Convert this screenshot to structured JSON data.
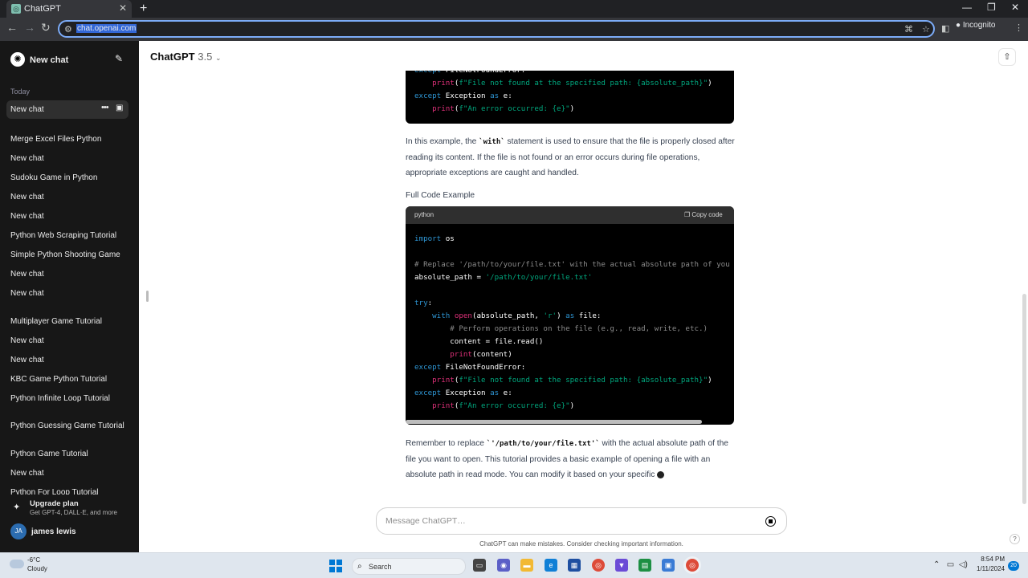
{
  "browser": {
    "tab_title": "ChatGPT",
    "url": "chat.openai.com",
    "incognito_label": "Incognito"
  },
  "sidebar": {
    "new_chat": "New chat",
    "section_today": "Today",
    "active_chat": "New chat",
    "history": [
      "Merge Excel Files Python",
      "New chat",
      "Sudoku Game in Python",
      "New chat",
      "New chat",
      "Python Web Scraping Tutorial",
      "Simple Python Shooting Game",
      "New chat",
      "New chat",
      "Multiplayer Game Tutorial",
      "New chat",
      "New chat",
      "KBC Game Python Tutorial",
      "Python Infinite Loop Tutorial",
      "Python Guessing Game Tutorial",
      "Python Game Tutorial",
      "New chat",
      "Python For Loop Tutorial"
    ],
    "upgrade_title": "Upgrade plan",
    "upgrade_sub": "Get GPT-4, DALL·E, and more",
    "user_initials": "JA",
    "user_name": "james lewis"
  },
  "header": {
    "model": "ChatGPT",
    "version": "3.5"
  },
  "message": {
    "code1_lines": [
      [
        [
          "kw",
          "except "
        ],
        [
          "",
          "FileNotFoundError:"
        ]
      ],
      [
        [
          "",
          "    "
        ],
        [
          "fn",
          "print"
        ],
        [
          "",
          "("
        ],
        [
          "st",
          "f\"File not found at the specified path: {absolute_path}\""
        ],
        [
          "",
          ")"
        ]
      ],
      [
        [
          "kw",
          "except "
        ],
        [
          "",
          "Exception "
        ],
        [
          "kw",
          "as "
        ],
        [
          "",
          "e:"
        ]
      ],
      [
        [
          "",
          "    "
        ],
        [
          "fn",
          "print"
        ],
        [
          "",
          "("
        ],
        [
          "st",
          "f\"An error occurred: {e}\""
        ],
        [
          "",
          ")"
        ]
      ]
    ],
    "p1_before": "In this example, the ",
    "p1_code": "`with`",
    "p1_after": " statement is used to ensure that the file is properly closed after reading its content. If the file is not found or an error occurs during file operations, appropriate exceptions are caught and handled.",
    "heading": "Full Code Example",
    "code_lang": "python",
    "copy_label": "Copy code",
    "code2_lines": [
      [
        [
          "kw",
          "import "
        ],
        [
          "",
          "os"
        ]
      ],
      [
        [
          "",
          ""
        ]
      ],
      [
        [
          "cm",
          "# Replace '/path/to/your/file.txt' with the actual absolute path of you"
        ]
      ],
      [
        [
          "",
          "absolute_path = "
        ],
        [
          "st",
          "'/path/to/your/file.txt'"
        ]
      ],
      [
        [
          "",
          ""
        ]
      ],
      [
        [
          "kw",
          "try"
        ],
        [
          "",
          ":"
        ]
      ],
      [
        [
          "",
          "    "
        ],
        [
          "kw",
          "with "
        ],
        [
          "fn",
          "open"
        ],
        [
          "",
          "(absolute_path, "
        ],
        [
          "st",
          "'r'"
        ],
        [
          "",
          ") "
        ],
        [
          "kw",
          "as "
        ],
        [
          "",
          "file:"
        ]
      ],
      [
        [
          "",
          "        "
        ],
        [
          "cm",
          "# Perform operations on the file (e.g., read, write, etc.)"
        ]
      ],
      [
        [
          "",
          "        content = file.read()"
        ]
      ],
      [
        [
          "",
          "        "
        ],
        [
          "fn",
          "print"
        ],
        [
          "",
          "(content)"
        ]
      ],
      [
        [
          "kw",
          "except "
        ],
        [
          "",
          "FileNotFoundError:"
        ]
      ],
      [
        [
          "",
          "    "
        ],
        [
          "fn",
          "print"
        ],
        [
          "",
          "("
        ],
        [
          "st",
          "f\"File not found at the specified path: {absolute_path}\""
        ],
        [
          "",
          ")"
        ]
      ],
      [
        [
          "kw",
          "except "
        ],
        [
          "",
          "Exception "
        ],
        [
          "kw",
          "as "
        ],
        [
          "",
          "e:"
        ]
      ],
      [
        [
          "",
          "    "
        ],
        [
          "fn",
          "print"
        ],
        [
          "",
          "("
        ],
        [
          "st",
          "f\"An error occurred: {e}\""
        ],
        [
          "",
          ")"
        ]
      ]
    ],
    "p2_before": "Remember to replace ",
    "p2_code": "`'/path/to/your/file.txt'`",
    "p2_after": " with the actual absolute path of the file you want to open. This tutorial provides a basic example of opening a file with an absolute path in read mode. You can modify it based on your specific "
  },
  "composer": {
    "placeholder": "Message ChatGPT…",
    "disclaimer": "ChatGPT can make mistakes. Consider checking important information."
  },
  "taskbar": {
    "temperature": "-6°C",
    "condition": "Cloudy",
    "search_label": "Search",
    "time": "8:54 PM",
    "date": "1/11/2024",
    "notifications": "20"
  }
}
